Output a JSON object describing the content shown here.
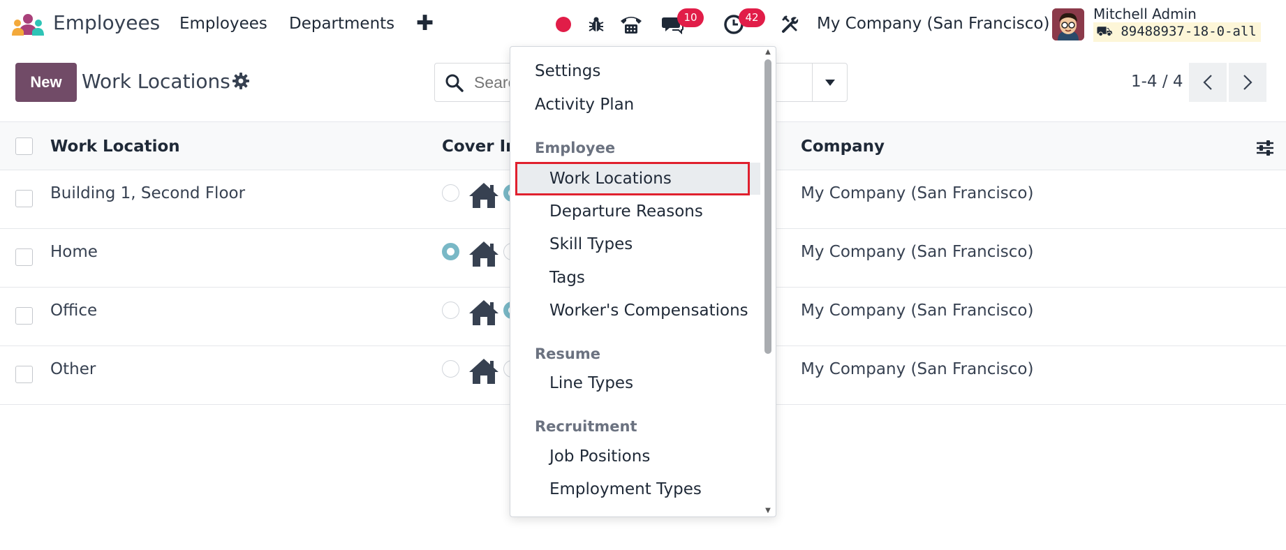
{
  "app": {
    "name": "Employees"
  },
  "navbar": {
    "links": [
      "Employees",
      "Departments"
    ],
    "plus": "✚",
    "messages_count": "10",
    "activities_count": "42",
    "company": "My Company (San Francisco)",
    "user_name": "Mitchell Admin",
    "db_name": "89488937-18-0-all"
  },
  "control": {
    "new_label": "New",
    "title": "Work Locations",
    "search_placeholder": "Search...",
    "pager": "1-4 / 4"
  },
  "list": {
    "columns": [
      "Work Location",
      "Cover Im",
      "Company"
    ],
    "rows": [
      {
        "name": "Building 1, Second Floor",
        "company": "My Company (San Francisco)",
        "selected_cover": "office"
      },
      {
        "name": "Home",
        "company": "My Company (San Francisco)",
        "selected_cover": "home"
      },
      {
        "name": "Office",
        "company": "My Company (San Francisco)",
        "selected_cover": "office"
      },
      {
        "name": "Other",
        "company": "My Company (San Francisco)",
        "selected_cover": "other"
      }
    ]
  },
  "menu": {
    "top_items": [
      "Settings",
      "Activity Plan"
    ],
    "sections": [
      {
        "heading": "Employee",
        "items": [
          "Work Locations",
          "Departure Reasons",
          "Skill Types",
          "Tags",
          "Worker's Compensations"
        ]
      },
      {
        "heading": "Resume",
        "items": [
          "Line Types"
        ]
      },
      {
        "heading": "Recruitment",
        "items": [
          "Job Positions",
          "Employment Types"
        ]
      }
    ],
    "active_item": "Work Locations"
  },
  "colors": {
    "brand": "#714b67",
    "badge": "#e11d48",
    "radio_checked": "#79b8c6",
    "highlight_box": "#e0202e"
  }
}
